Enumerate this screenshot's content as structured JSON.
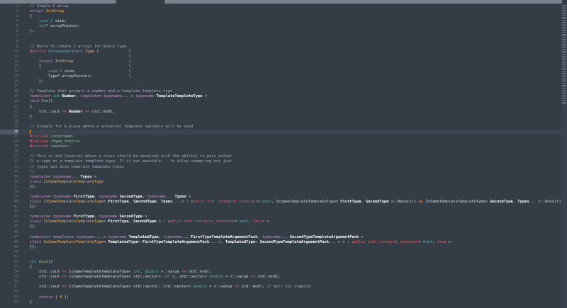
{
  "colors": {
    "background": "#343d46",
    "foreground": "#d8dee9",
    "tab_strip": "#7b828e",
    "comment": "#a6acb9",
    "keyword": "#c695c6",
    "primitive_type": "#5fb4b4",
    "entity_name": "#f9ae58",
    "function_name": "#99c794",
    "preprocessor": "#ec5f66",
    "operator": "#f97b58",
    "string": "#99c794",
    "cursor": "#f9ae58",
    "active_line_gutter": "#4e5a65"
  },
  "editor": {
    "cursor_line": 26,
    "total_lines": 60,
    "lines": [
      {
        "n": 1,
        "s": [
          [
            "c",
            "// Simple C array"
          ]
        ]
      },
      {
        "n": 2,
        "s": [
          [
            "k",
            "struct"
          ],
          [
            "p",
            " "
          ],
          [
            "n",
            "IntArray"
          ]
        ]
      },
      {
        "n": 3,
        "s": [
          [
            "p",
            "{"
          ]
        ]
      },
      {
        "n": 4,
        "s": [
          [
            "p",
            "    "
          ],
          [
            "t",
            "size_t"
          ],
          [
            "p",
            " size;"
          ]
        ]
      },
      {
        "n": 5,
        "s": [
          [
            "p",
            "    "
          ],
          [
            "t",
            "int"
          ],
          [
            "p",
            "* arrayPointer;"
          ]
        ]
      },
      {
        "n": 6,
        "s": [
          [
            "p",
            "};"
          ]
        ]
      },
      {
        "n": 7,
        "s": []
      },
      {
        "n": 8,
        "s": []
      },
      {
        "n": 9,
        "s": [
          [
            "c",
            "// Macro to create C arrays for every type"
          ]
        ]
      },
      {
        "n": 10,
        "s": [
          [
            "r",
            "#define"
          ],
          [
            "p",
            " "
          ],
          [
            "fc",
            "ArrayGenerator"
          ],
          [
            "p",
            "( "
          ],
          [
            "n",
            "Type"
          ],
          [
            "p",
            " )             "
          ],
          [
            "y",
            "\\"
          ]
        ]
      },
      {
        "n": 11,
        "s": [
          [
            "p",
            "                                           "
          ],
          [
            "y",
            "\\"
          ]
        ]
      },
      {
        "n": 12,
        "s": [
          [
            "p",
            "    "
          ],
          [
            "k",
            "struct"
          ],
          [
            "p",
            " "
          ],
          [
            "n",
            "IntArray"
          ],
          [
            "p",
            "                        "
          ],
          [
            "y",
            "\\"
          ]
        ]
      },
      {
        "n": 13,
        "s": [
          [
            "p",
            "    {                                      "
          ],
          [
            "y",
            "\\"
          ]
        ]
      },
      {
        "n": 14,
        "s": [
          [
            "p",
            "        "
          ],
          [
            "t",
            "size_t"
          ],
          [
            "p",
            " size;                       "
          ],
          [
            "y",
            "\\"
          ]
        ]
      },
      {
        "n": 15,
        "s": [
          [
            "p",
            "        Type* arrayPointer;                "
          ],
          [
            "y",
            "\\"
          ]
        ]
      },
      {
        "n": 16,
        "s": [
          [
            "p",
            "    };"
          ]
        ]
      },
      {
        "n": 17,
        "s": []
      },
      {
        "n": 18,
        "s": [
          [
            "c",
            "// Template that accepts a number and a template template type"
          ]
        ]
      },
      {
        "n": 19,
        "s": [
          [
            "k",
            "template"
          ],
          [
            "p",
            "< "
          ],
          [
            "t",
            "int"
          ],
          [
            "p",
            " "
          ],
          [
            "b",
            "Number"
          ],
          [
            "p",
            ", "
          ],
          [
            "k",
            "template"
          ],
          [
            "p",
            "< "
          ],
          [
            "k",
            "typename"
          ],
          [
            "p",
            "... > "
          ],
          [
            "k",
            "typename"
          ],
          [
            "p",
            " "
          ],
          [
            "b",
            "TemplateTemplateType"
          ],
          [
            "p",
            " >"
          ]
        ]
      },
      {
        "n": 20,
        "s": [
          [
            "k",
            "void"
          ],
          [
            "p",
            " "
          ],
          [
            "f",
            "Foo"
          ],
          [
            "p",
            "()"
          ]
        ]
      },
      {
        "n": 21,
        "s": [
          [
            "p",
            "{"
          ]
        ]
      },
      {
        "n": 22,
        "s": [
          [
            "p",
            "    std::cout "
          ],
          [
            "o",
            "<<"
          ],
          [
            "p",
            " "
          ],
          [
            "b",
            "Number"
          ],
          [
            "p",
            " "
          ],
          [
            "o",
            "<<"
          ],
          [
            "p",
            " std::endl;"
          ]
        ]
      },
      {
        "n": 23,
        "s": [
          [
            "p",
            "}"
          ]
        ]
      },
      {
        "n": 24,
        "s": []
      },
      {
        "n": 25,
        "s": [
          [
            "c",
            "// Example for a place where a universal template vairable will be used"
          ]
        ]
      },
      {
        "n": 26,
        "s": []
      },
      {
        "n": 27,
        "s": [
          [
            "r",
            "#include"
          ],
          [
            "p",
            " "
          ],
          [
            "s",
            "<iostream>"
          ]
        ]
      },
      {
        "n": 28,
        "s": [
          [
            "r",
            "#include"
          ],
          [
            "p",
            " "
          ],
          [
            "s",
            "<type_traits>"
          ]
        ]
      },
      {
        "n": 29,
        "s": [
          [
            "r",
            "#include"
          ],
          [
            "p",
            " "
          ],
          [
            "s",
            "<vector>"
          ]
        ]
      },
      {
        "n": 30,
        "s": []
      },
      {
        "n": 31,
        "s": [
          [
            "c",
            "// This is the location where a class should be decalred with the ability to pass either"
          ]
        ]
      },
      {
        "n": 32,
        "s": [
          [
            "c",
            "// a type or a template template type. If it was possible... to allow comapring not just"
          ]
        ]
      },
      {
        "n": 33,
        "s": [
          [
            "c",
            "// types but also template template types"
          ]
        ]
      },
      {
        "n": 34,
        "s": [
          [
            "c",
            "//"
          ]
        ]
      },
      {
        "n": 35,
        "s": [
          [
            "k",
            "template"
          ],
          [
            "p",
            "< "
          ],
          [
            "k",
            "typename"
          ],
          [
            "p",
            "... "
          ],
          [
            "b",
            "Types"
          ],
          [
            "p",
            " >"
          ]
        ]
      },
      {
        "n": 36,
        "s": [
          [
            "k",
            "class"
          ],
          [
            "p",
            " "
          ],
          [
            "n",
            "IsSameTemplateTemplateType"
          ]
        ]
      },
      {
        "n": 37,
        "s": [
          [
            "p",
            "{};"
          ]
        ]
      },
      {
        "n": 38,
        "s": []
      },
      {
        "n": 39,
        "s": [
          [
            "k",
            "template"
          ],
          [
            "p",
            "< "
          ],
          [
            "k",
            "typename"
          ],
          [
            "p",
            " "
          ],
          [
            "b",
            "FirstType"
          ],
          [
            "p",
            ", "
          ],
          [
            "k",
            "typename"
          ],
          [
            "p",
            " "
          ],
          [
            "b",
            "SecondType"
          ],
          [
            "p",
            ", "
          ],
          [
            "k",
            "typename"
          ],
          [
            "p",
            "... "
          ],
          [
            "b",
            "Types"
          ],
          [
            "p",
            " >"
          ]
        ]
      },
      {
        "n": 40,
        "s": [
          [
            "k",
            "class"
          ],
          [
            "p",
            " "
          ],
          [
            "n",
            "IsSameTemplateTemplateType"
          ],
          [
            "p",
            "< "
          ],
          [
            "b",
            "FirstType"
          ],
          [
            "p",
            ", "
          ],
          [
            "b",
            "SecondType"
          ],
          [
            "p",
            ", "
          ],
          [
            "b",
            "Types"
          ],
          [
            "p",
            "... > : "
          ],
          [
            "r",
            "public"
          ],
          [
            "p",
            " "
          ],
          [
            "ri",
            "std::integral_constant"
          ],
          [
            "p",
            "< "
          ],
          [
            "t",
            "bool"
          ],
          [
            "p",
            ", IsSameTemplateTemplateType< "
          ],
          [
            "b",
            "FirstType"
          ],
          [
            "p",
            ", "
          ],
          [
            "b",
            "SecondType"
          ],
          [
            "p",
            " >::Result() "
          ],
          [
            "o",
            "&&"
          ],
          [
            "p",
            " IsSameTemplateTemplateType< "
          ],
          [
            "b",
            "SecondType"
          ],
          [
            "p",
            ", "
          ],
          [
            "b",
            "Types"
          ],
          [
            "p",
            "... >::Result() >"
          ]
        ]
      },
      {
        "n": 41,
        "s": [
          [
            "p",
            "{};"
          ]
        ]
      },
      {
        "n": 42,
        "s": []
      },
      {
        "n": 43,
        "s": [
          [
            "k",
            "template"
          ],
          [
            "p",
            "< "
          ],
          [
            "k",
            "typename"
          ],
          [
            "p",
            " "
          ],
          [
            "b",
            "FirstType"
          ],
          [
            "p",
            ", "
          ],
          [
            "k",
            "typename"
          ],
          [
            "p",
            " "
          ],
          [
            "b",
            "SecondType"
          ],
          [
            "p",
            " >"
          ]
        ]
      },
      {
        "n": 44,
        "s": [
          [
            "k",
            "class"
          ],
          [
            "p",
            " "
          ],
          [
            "n",
            "IsSameTemplateTemplateType"
          ],
          [
            "p",
            "< "
          ],
          [
            "b",
            "FirstType"
          ],
          [
            "p",
            ", "
          ],
          [
            "b",
            "SecondType"
          ],
          [
            "p",
            " > : "
          ],
          [
            "r",
            "public"
          ],
          [
            "p",
            " "
          ],
          [
            "ri",
            "std::integral_constant"
          ],
          [
            "p",
            "< "
          ],
          [
            "t",
            "bool"
          ],
          [
            "p",
            ", "
          ],
          [
            "r",
            "false"
          ],
          [
            "p",
            " >"
          ]
        ]
      },
      {
        "n": 45,
        "s": [
          [
            "p",
            "{};"
          ]
        ]
      },
      {
        "n": 46,
        "s": []
      },
      {
        "n": 47,
        "s": [
          [
            "k",
            "template"
          ],
          [
            "p",
            "< "
          ],
          [
            "k",
            "template"
          ],
          [
            "p",
            "< "
          ],
          [
            "k",
            "typename"
          ],
          [
            "p",
            "... > "
          ],
          [
            "k",
            "typename"
          ],
          [
            "p",
            " "
          ],
          [
            "b",
            "TemplatedType"
          ],
          [
            "p",
            ", "
          ],
          [
            "k",
            "typename"
          ],
          [
            "p",
            "... "
          ],
          [
            "b",
            "FirstTypeTemplateArgumentPack"
          ],
          [
            "p",
            ", "
          ],
          [
            "k",
            "typename"
          ],
          [
            "p",
            "... "
          ],
          [
            "b",
            "SecondTypeTemplateArgumentPack"
          ],
          [
            "p",
            " >"
          ]
        ]
      },
      {
        "n": 48,
        "s": [
          [
            "k",
            "class"
          ],
          [
            "p",
            " "
          ],
          [
            "n",
            "IsSameTemplateTemplateType"
          ],
          [
            "p",
            "< "
          ],
          [
            "b",
            "TemplatedType"
          ],
          [
            "p",
            "< "
          ],
          [
            "b",
            "FirstTypeTemplateArgumentPack"
          ],
          [
            "p",
            "... >, "
          ],
          [
            "b",
            "TemplatedType"
          ],
          [
            "p",
            "< "
          ],
          [
            "b",
            "SecondTypeTemplateArgumentPack"
          ],
          [
            "p",
            "... > > : "
          ],
          [
            "r",
            "public"
          ],
          [
            "p",
            " "
          ],
          [
            "ri",
            "std::integral_constant"
          ],
          [
            "p",
            "< "
          ],
          [
            "t",
            "bool"
          ],
          [
            "p",
            ", "
          ],
          [
            "r",
            "true"
          ],
          [
            "p",
            " >"
          ]
        ]
      },
      {
        "n": 49,
        "s": [
          [
            "p",
            "{};"
          ]
        ]
      },
      {
        "n": 50,
        "s": []
      },
      {
        "n": 51,
        "s": []
      },
      {
        "n": 52,
        "s": [
          [
            "t",
            "int"
          ],
          [
            "p",
            " "
          ],
          [
            "f",
            "main"
          ],
          [
            "p",
            "()"
          ]
        ]
      },
      {
        "n": 53,
        "s": [
          [
            "p",
            "{"
          ]
        ]
      },
      {
        "n": 54,
        "s": [
          [
            "p",
            "    std::cout "
          ],
          [
            "o",
            "<<"
          ],
          [
            "p",
            " IsSameTemplateTemplateType< "
          ],
          [
            "t",
            "int"
          ],
          [
            "p",
            ", "
          ],
          [
            "t",
            "double"
          ],
          [
            "p",
            " >::value "
          ],
          [
            "o",
            "<<"
          ],
          [
            "p",
            " std::endl;"
          ]
        ]
      },
      {
        "n": 55,
        "s": [
          [
            "p",
            "    std::cout "
          ],
          [
            "o",
            "<<"
          ],
          [
            "p",
            " IsSameTemplateTemplateType< std::vector< "
          ],
          [
            "t",
            "int"
          ],
          [
            "p",
            " >, std::vector< "
          ],
          [
            "t",
            "double"
          ],
          [
            "p",
            " > >::value "
          ],
          [
            "o",
            "<<"
          ],
          [
            "p",
            " std::endl;"
          ]
        ]
      },
      {
        "n": 56,
        "s": []
      },
      {
        "n": 57,
        "s": [
          [
            "p",
            "    std::cout "
          ],
          [
            "o",
            "<<"
          ],
          [
            "p",
            " IsSameTemplateTemplateType< std::vector, std::vector< "
          ],
          [
            "t",
            "double"
          ],
          [
            "p",
            " > >::value "
          ],
          [
            "o",
            "<<"
          ],
          [
            "p",
            " std::endl; "
          ],
          [
            "c",
            "// Will not compile"
          ]
        ]
      },
      {
        "n": 58,
        "s": []
      },
      {
        "n": 59,
        "s": [
          [
            "p",
            "    "
          ],
          [
            "k",
            "return"
          ],
          [
            "p",
            " ( "
          ],
          [
            "n",
            "0"
          ],
          [
            "p",
            " );"
          ]
        ]
      },
      {
        "n": 60,
        "s": [
          [
            "p",
            "}"
          ]
        ]
      }
    ]
  }
}
